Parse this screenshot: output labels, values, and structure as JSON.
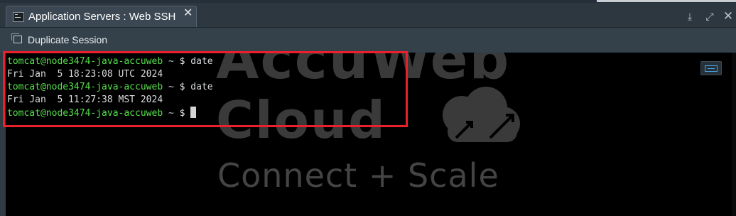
{
  "tab": {
    "title": "Application Servers : Web SSH",
    "close_glyph": "✕",
    "icon": "terminal-icon"
  },
  "window_controls": {
    "download_glyph": "⤓",
    "expand_glyph": "⤢",
    "close_glyph": "✕"
  },
  "toolbar": {
    "duplicate_label": "Duplicate Session"
  },
  "terminal": {
    "lines": [
      {
        "user": "tomcat@node3474-java-accuweb",
        "sep": " ~ ",
        "dollar": "$",
        "cmd": " date"
      },
      {
        "output": "Fri Jan  5 18:23:08 UTC 2024"
      },
      {
        "user": "tomcat@node3474-java-accuweb",
        "sep": " ~ ",
        "dollar": "$",
        "cmd": " date"
      },
      {
        "output": "Fri Jan  5 11:27:38 MST 2024"
      },
      {
        "user": "tomcat@node3474-java-accuweb",
        "sep": " ~ ",
        "dollar": "$",
        "cmd": " "
      }
    ]
  },
  "watermark": {
    "line1": "AccuWeb",
    "line2": "Cloud",
    "tagline": "Connect + Scale"
  },
  "colors": {
    "prompt_user": "#55e04a",
    "highlight": "#e8212c",
    "terminal_bg": "#000000"
  }
}
